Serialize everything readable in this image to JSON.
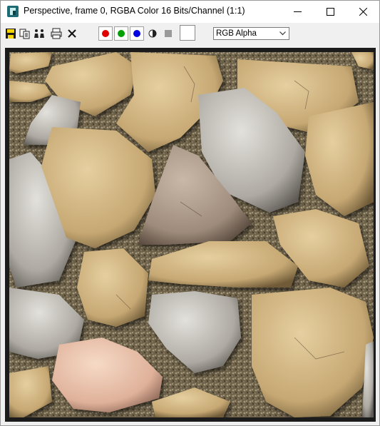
{
  "window": {
    "title": "Perspective, frame 0, RGBA Color 16 Bits/Channel (1:1)"
  },
  "toolbar": {
    "channel_select_value": "RGB Alpha",
    "channel_buttons": [
      {
        "name": "red-channel",
        "color": "#e00000"
      },
      {
        "name": "green-channel",
        "color": "#00a000"
      },
      {
        "name": "blue-channel",
        "color": "#0000e0"
      }
    ],
    "swatch_color": "#ffffff"
  },
  "image": {
    "subject": "cobblestone texture render"
  }
}
